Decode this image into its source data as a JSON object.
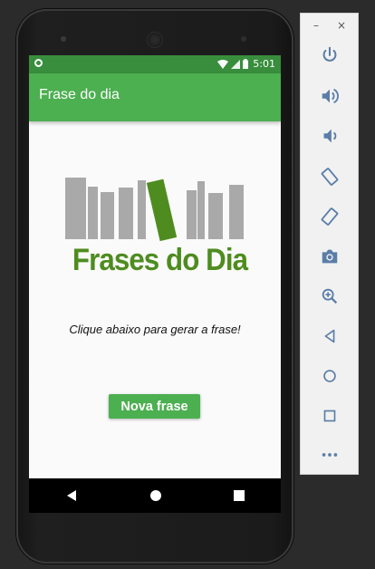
{
  "status_bar": {
    "time": "5:01"
  },
  "app_bar": {
    "title": "Frase do dia"
  },
  "logo": {
    "text": "Frases do Dia"
  },
  "main": {
    "prompt": "Clique abaixo para gerar a frase!",
    "button_label": "Nova frase"
  },
  "nav_bar": {
    "icons": [
      "back-icon",
      "home-icon",
      "recents-icon"
    ]
  },
  "emulator_panel": {
    "window_controls": {
      "minimize": "–",
      "close": "×"
    },
    "tools": [
      "power-icon",
      "volume-up-icon",
      "volume-down-icon",
      "rotate-left-icon",
      "rotate-right-icon",
      "camera-icon",
      "zoom-icon",
      "back-icon",
      "home-icon",
      "overview-icon",
      "more-icon"
    ]
  },
  "colors": {
    "app_bar": "#4caf50",
    "status_bar": "#388e3c",
    "logo_green": "#4e8c1f",
    "logo_gray": "#a9a9a9",
    "button": "#4caf50",
    "panel_icon": "#5a7da8"
  }
}
